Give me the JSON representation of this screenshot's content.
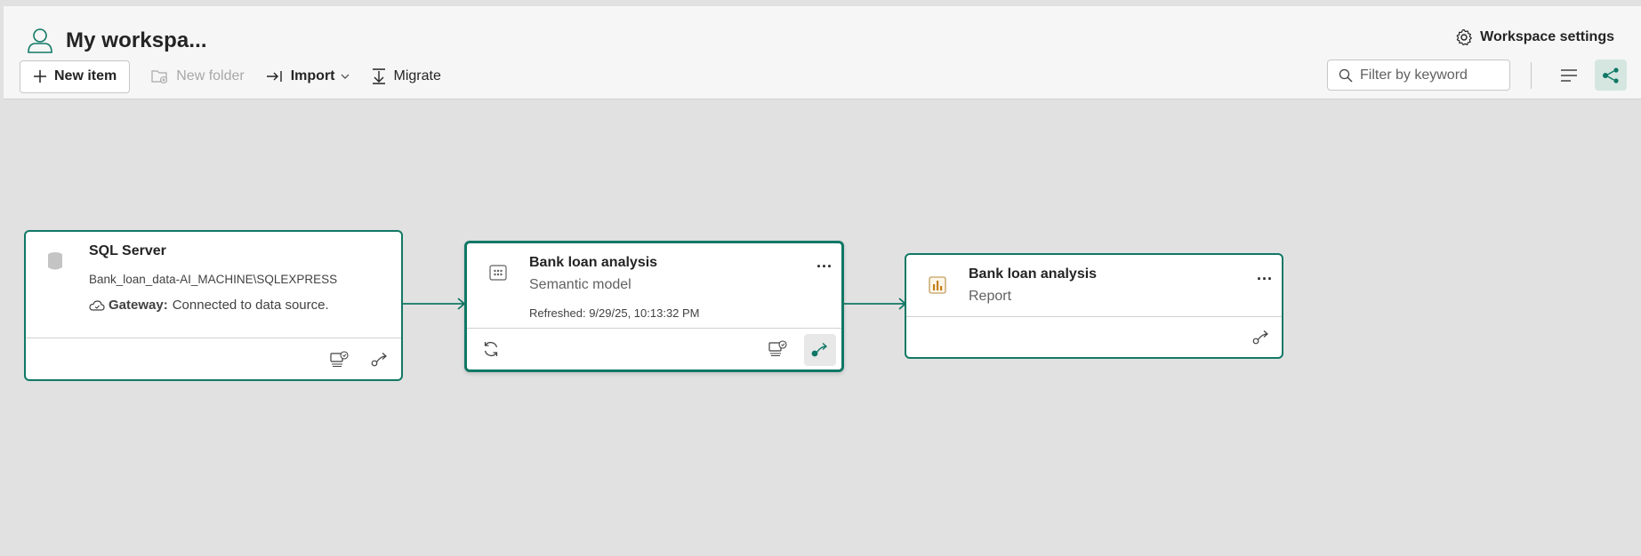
{
  "header": {
    "workspace_title": "My workspa...",
    "settings_label": "Workspace settings"
  },
  "toolbar": {
    "new_item_label": "New item",
    "new_folder_label": "New folder",
    "import_label": "Import",
    "migrate_label": "Migrate"
  },
  "filter": {
    "placeholder": "Filter by keyword"
  },
  "lineage": {
    "source": {
      "title": "SQL Server",
      "connection": "Bank_loan_data-AI_MACHINE\\SQLEXPRESS",
      "gateway_label": "Gateway:",
      "gateway_status": "Connected to data source."
    },
    "semantic_model": {
      "title": "Bank loan analysis",
      "type": "Semantic model",
      "refreshed": "Refreshed: 9/29/25, 10:13:32 PM",
      "more": "..."
    },
    "report": {
      "title": "Bank loan analysis",
      "type": "Report",
      "more": "..."
    }
  },
  "colors": {
    "accent": "#117865",
    "toolbar_bg": "#f6f6f6",
    "canvas_bg": "#e1e1e1"
  }
}
